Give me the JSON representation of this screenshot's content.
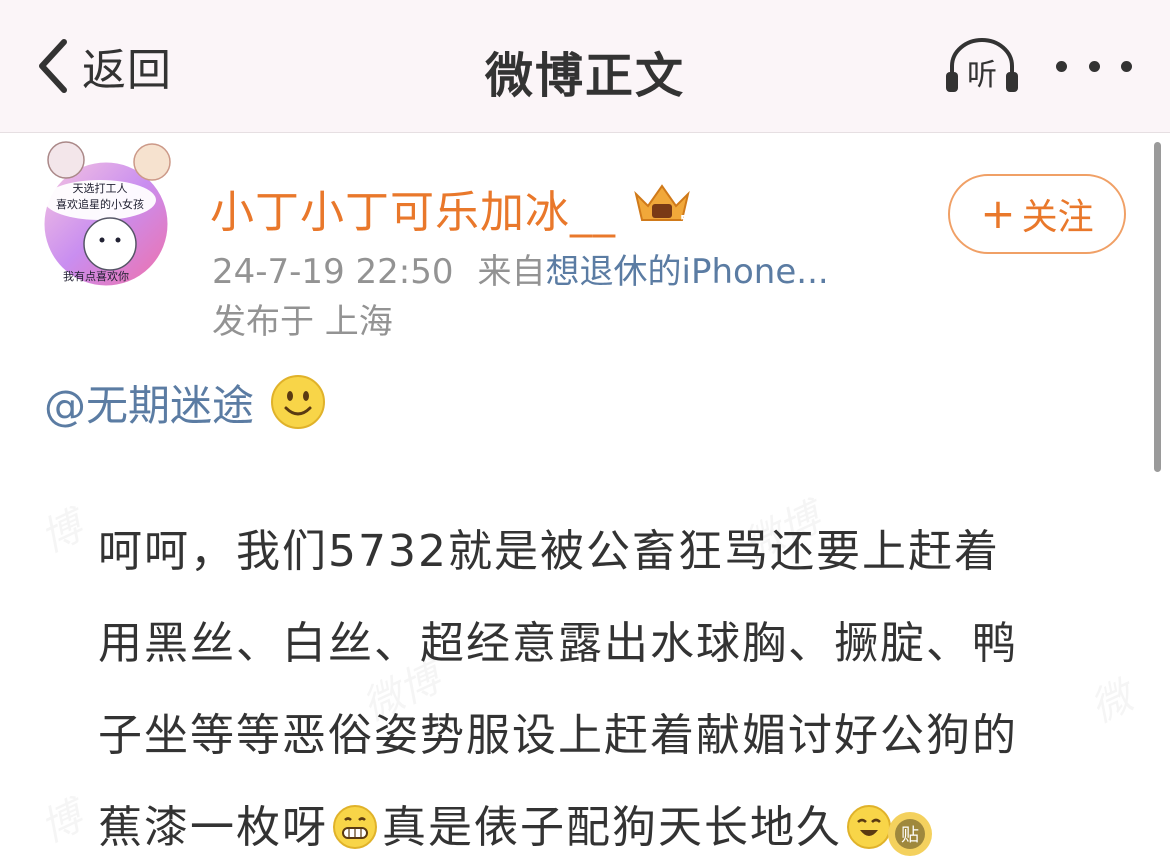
{
  "header": {
    "back_label": "返回",
    "title": "微博正文",
    "listen_label": "听"
  },
  "author": {
    "name": "小丁小丁可乐加冰__",
    "time": "24-7-19 22:50",
    "source_prefix": "来自",
    "source_name": "想退休的iPhone...",
    "location": "发布于 上海",
    "follow_label": "关注",
    "follow_plus": "+",
    "avatar_text_top": "天选打工人",
    "avatar_text_mid": "喜欢追星的小女孩",
    "avatar_text_bottom": "我有点喜欢你",
    "colors": {
      "name": "#e9782b",
      "link": "#5b7ca3"
    }
  },
  "post": {
    "mention": "@无期迷途",
    "lines": {
      "l1": "呵呵，我们5732就是被公畜狂骂还要上赶着",
      "l2": "用黑丝、白丝、超经意露出水球胸、撅腚、鸭",
      "l3": "子坐等等恶俗姿势服设上赶着献媚讨好公狗的",
      "l4a": "蕉漆一枚呀",
      "l4b": "真是俵子配狗天长地久"
    },
    "emojis": [
      "smile-emoji",
      "grin-emoji",
      "laugh-emoji"
    ],
    "badge_text": "贴"
  }
}
